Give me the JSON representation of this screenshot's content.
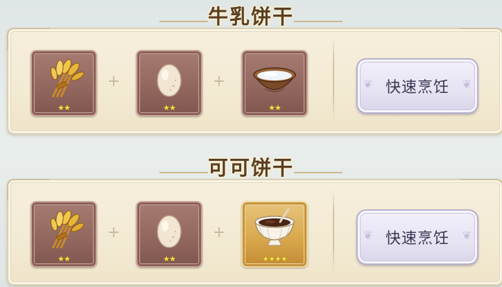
{
  "recipes": [
    {
      "title": "牛乳饼干",
      "ingredients": [
        {
          "icon": "wheat-icon",
          "stars": "★★",
          "rarity": "common"
        },
        {
          "icon": "egg-icon",
          "stars": "★★",
          "rarity": "common"
        },
        {
          "icon": "milk-bowl-icon",
          "stars": "★★",
          "rarity": "common"
        }
      ],
      "plus": "+",
      "button_label": "快速烹饪"
    },
    {
      "title": "可可饼干",
      "ingredients": [
        {
          "icon": "wheat-icon",
          "stars": "★★",
          "rarity": "common"
        },
        {
          "icon": "egg-icon",
          "stars": "★★",
          "rarity": "common"
        },
        {
          "icon": "chocolate-sauce-icon",
          "stars": "★★★★",
          "rarity": "gold"
        }
      ],
      "plus": "+",
      "button_label": "快速烹饪"
    }
  ],
  "colors": {
    "panel_bg": "#f3ead3",
    "slot_common": "#93685f",
    "slot_gold": "#d9a94d",
    "button_bg": "#e6e3f3",
    "title_text": "#5a3e24"
  }
}
